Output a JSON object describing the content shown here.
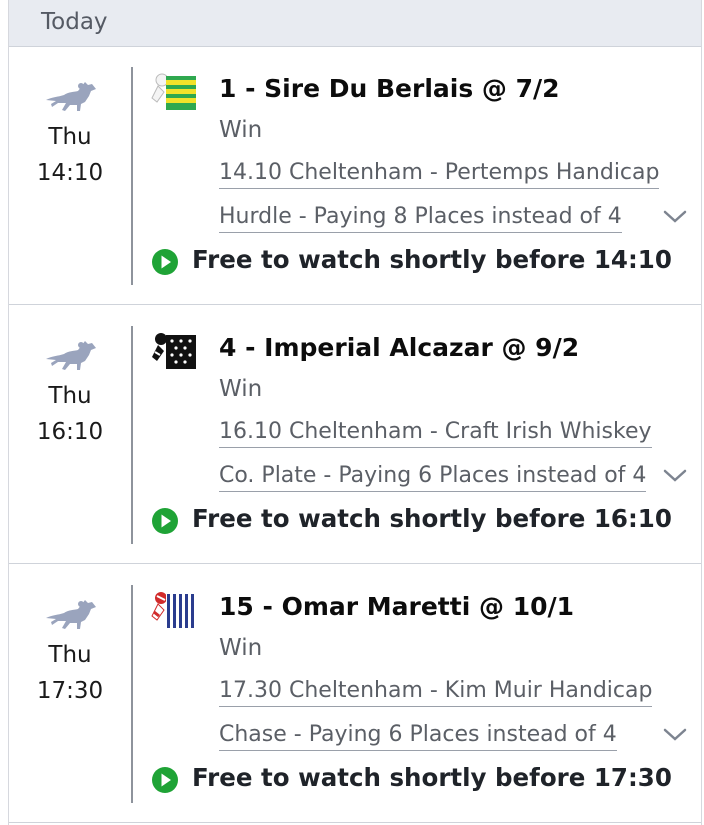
{
  "header": {
    "label": "Today"
  },
  "bets": [
    {
      "day": "Thu",
      "time": "14:10",
      "selection": "1 - Sire Du Berlais @ 7/2",
      "bet_type": "Win",
      "event_line1": "14.10 Cheltenham - Pertemps Handicap",
      "event_line2": "Hurdle - Paying 8 Places instead of 4",
      "watch": "Free to watch shortly before 14:10",
      "silk_icon": "green-yellow-hoops-silk-icon"
    },
    {
      "day": "Thu",
      "time": "16:10",
      "selection": "4 - Imperial Alcazar @ 9/2",
      "bet_type": "Win",
      "event_line1": "16.10 Cheltenham - Craft Irish Whiskey",
      "event_line2": "Co. Plate - Paying 6 Places instead of 4",
      "watch": "Free to watch shortly before 16:10",
      "silk_icon": "black-white-spots-silk-icon"
    },
    {
      "day": "Thu",
      "time": "17:30",
      "selection": "15 - Omar Maretti @ 10/1",
      "bet_type": "Win",
      "event_line1": "17.30 Cheltenham - Kim Muir Handicap",
      "event_line2": "Chase - Paying 6 Places instead of 4",
      "watch": "Free to watch shortly before 17:30",
      "silk_icon": "blue-white-stripes-red-cap-silk-icon"
    }
  ],
  "colors": {
    "header_bg": "#e8ebf1",
    "play_green": "#1fa336",
    "horse_grey": "#9aa4bd",
    "text_muted": "#5b5f66"
  }
}
